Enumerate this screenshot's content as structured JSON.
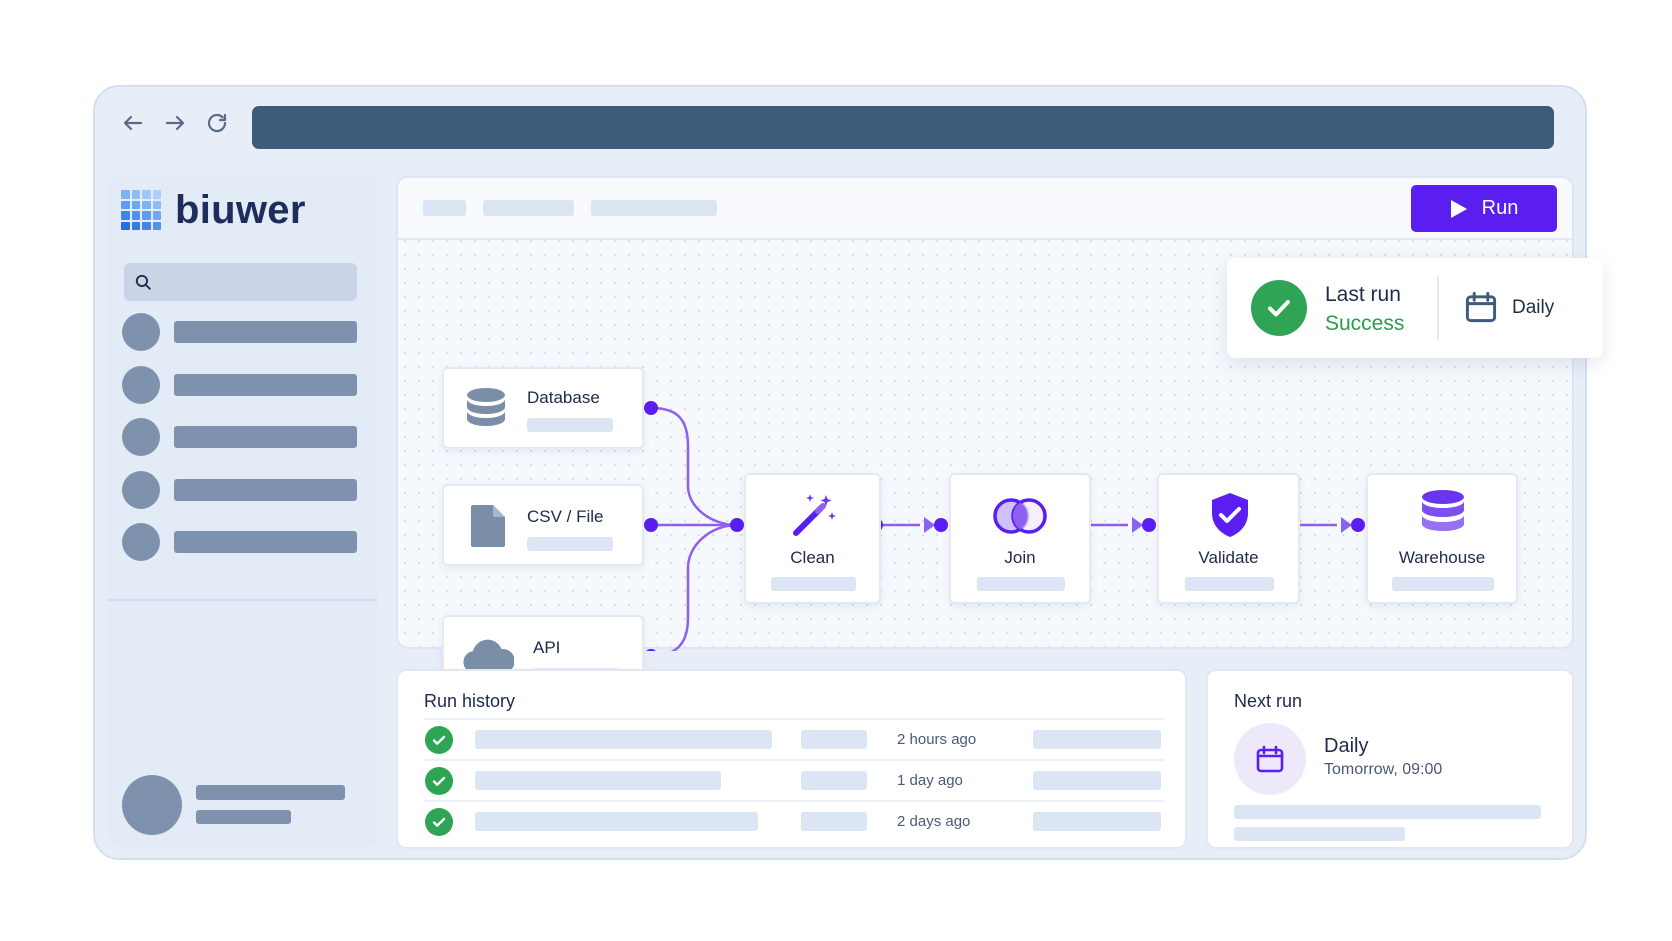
{
  "brand": {
    "name": "biuwer",
    "colors": {
      "accent": "#5a1ff0",
      "success": "#2d9a4e",
      "node_icon": "#7b8ea8"
    }
  },
  "browser": {
    "icons": [
      "back-arrow-icon",
      "forward-arrow-icon",
      "reload-icon"
    ]
  },
  "sidebar": {
    "search_icon": "search-icon"
  },
  "toolbar": {
    "run_label": "Run",
    "run_icon": "play-icon"
  },
  "status": {
    "title": "Last run",
    "value": "Success",
    "schedule": "Daily"
  },
  "pipeline": {
    "sources": [
      {
        "label": "Database",
        "icon": "database-icon"
      },
      {
        "label": "CSV / File",
        "icon": "file-icon"
      },
      {
        "label": "API",
        "icon": "cloud-icon"
      }
    ],
    "steps": [
      {
        "label": "Clean",
        "icon": "magic-wand-icon"
      },
      {
        "label": "Join",
        "icon": "join-circles-icon"
      },
      {
        "label": "Validate",
        "icon": "shield-check-icon"
      },
      {
        "label": "Warehouse",
        "icon": "database-icon"
      }
    ]
  },
  "run_history": {
    "title": "Run history",
    "rows": [
      {
        "time": "2 hours ago",
        "status": "success"
      },
      {
        "time": "1 day ago",
        "status": "success"
      },
      {
        "time": "2 days ago",
        "status": "success"
      }
    ]
  },
  "next_run": {
    "title": "Next run",
    "label": "Daily",
    "time": "Tomorrow, 09:00",
    "icon": "calendar-icon"
  }
}
